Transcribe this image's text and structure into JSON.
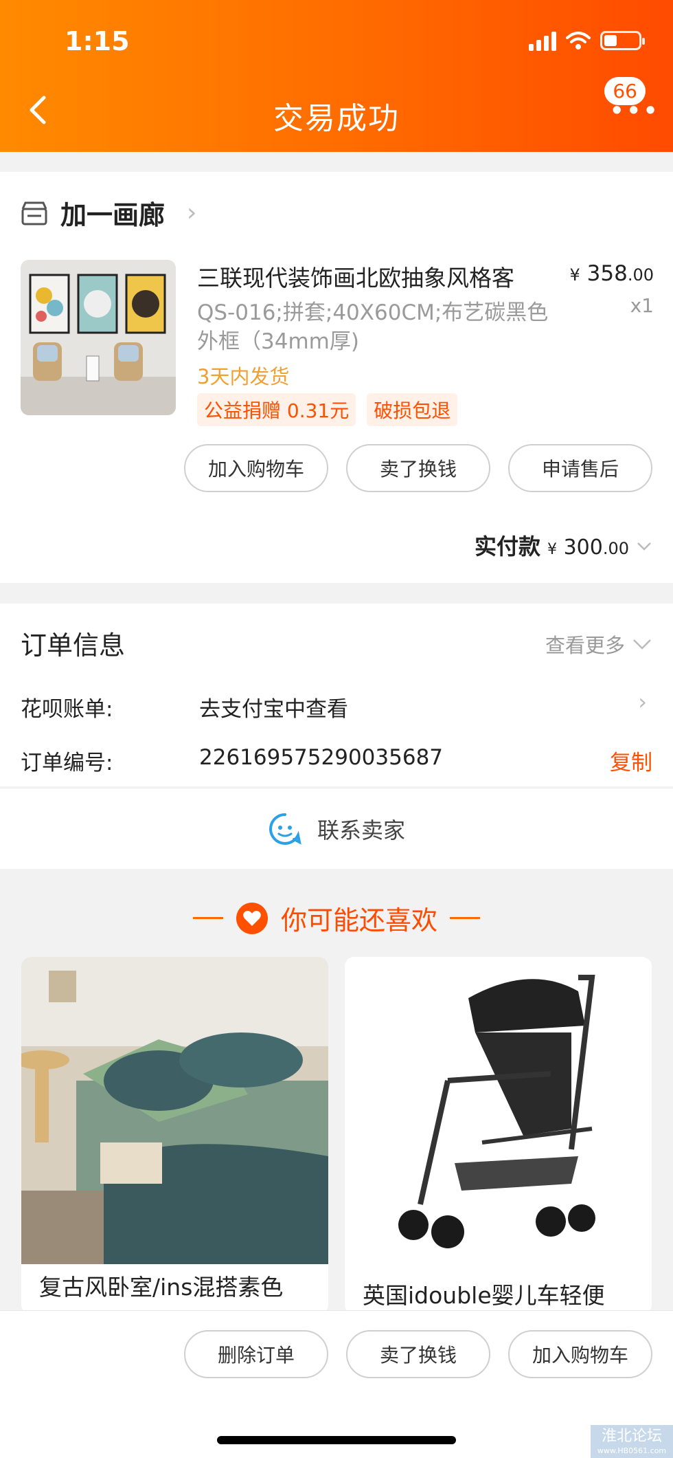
{
  "status_bar": {
    "time": "1:15"
  },
  "header": {
    "title": "交易成功",
    "back_icon": "chevron-left-icon",
    "more_icon": "more-dots-icon",
    "badge_count": "66"
  },
  "order": {
    "shop_name": "加一画廊",
    "product": {
      "title": "三联现代装饰画北欧抽象风格客",
      "spec": "QS-016;拼套;40X60CM;布艺碳黑色外框（34mm厚)",
      "shipping": "3天内发货",
      "tags": [
        "公益捐赠 0.31元",
        "破损包退"
      ],
      "currency": "¥",
      "price_int": "358",
      "price_dec": ".00",
      "qty": "x1"
    },
    "buttons": [
      "加入购物车",
      "卖了换钱",
      "申请售后"
    ],
    "paid_label": "实付款",
    "paid_currency": "¥",
    "paid_int": "300",
    "paid_dec": ".00"
  },
  "order_info": {
    "title": "订单信息",
    "see_more": "查看更多",
    "rows": [
      {
        "label": "花呗账单:",
        "value": "去支付宝中查看"
      },
      {
        "label": "订单编号:",
        "value": "226169575290035687",
        "action": "复制"
      }
    ],
    "contact": "联系卖家"
  },
  "recommend": {
    "title": "你可能还喜欢",
    "items": [
      {
        "name": "复古风卧室/ins混搭素色"
      },
      {
        "name": "英国idouble婴儿车轻便"
      }
    ]
  },
  "bottom_bar": {
    "buttons": [
      "删除订单",
      "卖了换钱",
      "加入购物车"
    ]
  },
  "watermark": {
    "text": "淮北论坛",
    "sub": "www.HB0561.com"
  },
  "colors": {
    "accent": "#ff5000",
    "header_start": "#ff8a00",
    "header_end": "#ff4b00"
  }
}
